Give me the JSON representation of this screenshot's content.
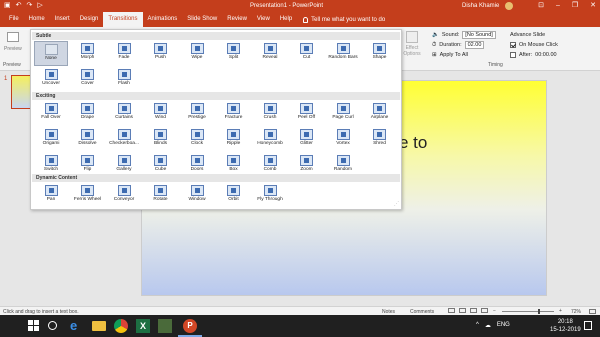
{
  "titlebar": {
    "title": "Presentation1 - PowerPoint",
    "user": "Disha Khamie",
    "quick_access": [
      "save",
      "undo",
      "redo",
      "start"
    ],
    "window_controls": [
      "ribbon-display",
      "minimize",
      "restore",
      "close"
    ]
  },
  "tabs": [
    "File",
    "Home",
    "Insert",
    "Design",
    "Transitions",
    "Animations",
    "Slide Show",
    "Review",
    "View",
    "Help"
  ],
  "active_tab": "Transitions",
  "tell_me": "Tell me what you want to do",
  "ribbon": {
    "preview_label": "Preview",
    "preview_group": "Preview",
    "effect_options": "Effect Options",
    "timing_group": "Timing",
    "sound_label": "Sound:",
    "sound_value": "[No Sound]",
    "duration_label": "Duration:",
    "duration_value": "02.00",
    "apply_all": "Apply To All",
    "advance_slide": "Advance Slide",
    "on_mouse_click": "On Mouse Click",
    "on_mouse_click_checked": true,
    "after_label": "After:",
    "after_checked": false,
    "after_value": "00:00.00"
  },
  "gallery": {
    "subtle_header": "Subtle",
    "subtle": [
      "None",
      "Morph",
      "Fade",
      "Push",
      "Wipe",
      "Split",
      "Reveal",
      "Cut",
      "Random Bars",
      "Shape",
      "Uncover",
      "Cover",
      "Flash"
    ],
    "exciting_header": "Exciting",
    "exciting": [
      "Fall Over",
      "Drape",
      "Curtains",
      "Wind",
      "Prestige",
      "Fracture",
      "Crush",
      "Peel Off",
      "Page Curl",
      "Airplane",
      "Origami",
      "Dissolve",
      "Checkerboa...",
      "Blinds",
      "Clock",
      "Ripple",
      "Honeycomb",
      "Glitter",
      "Vortex",
      "Shred",
      "Switch",
      "Flip",
      "Gallery",
      "Cube",
      "Doors",
      "Box",
      "Comb",
      "Zoom",
      "Random"
    ],
    "dynamic_header": "Dynamic Content",
    "dynamic": [
      "Pan",
      "Ferris Wheel",
      "Conveyor",
      "Rotate",
      "Window",
      "Orbit",
      "Fly Through"
    ],
    "selected": "None"
  },
  "slides": {
    "number": "1",
    "visible_text": "e to"
  },
  "statusbar": {
    "message": "Click and drag to insert a text box.",
    "notes": "Notes",
    "comments": "Comments",
    "zoom_minus": "−",
    "zoom_plus": "+",
    "zoom": "72%"
  },
  "taskbar": {
    "time": "20:18",
    "date": "15-12-2019",
    "tray": [
      "^",
      "☁",
      "ENG"
    ]
  }
}
